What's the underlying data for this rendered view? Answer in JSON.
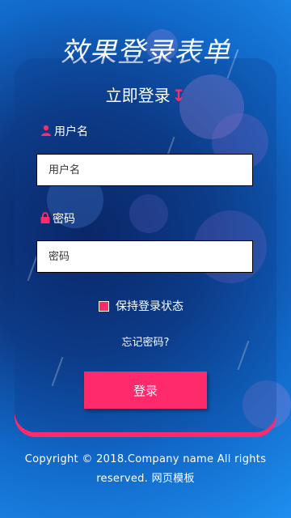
{
  "page": {
    "title": "效果登录表单"
  },
  "card": {
    "title": "立即登录",
    "title_icon": "arrow-down-icon"
  },
  "username": {
    "label": "用户名",
    "icon": "user-icon",
    "placeholder": "用户名"
  },
  "password": {
    "label": "密码",
    "icon": "lock-icon",
    "placeholder": "密码"
  },
  "remember": {
    "label": "保持登录状态",
    "checked": true
  },
  "forgot": {
    "label": "忘记密码?"
  },
  "login_button": {
    "label": "登录"
  },
  "footer": {
    "text": "Copyright © 2018.Company name All rights reserved. 网页模板"
  },
  "colors": {
    "accent": "#ff2a6c",
    "background": "#1168c8"
  }
}
